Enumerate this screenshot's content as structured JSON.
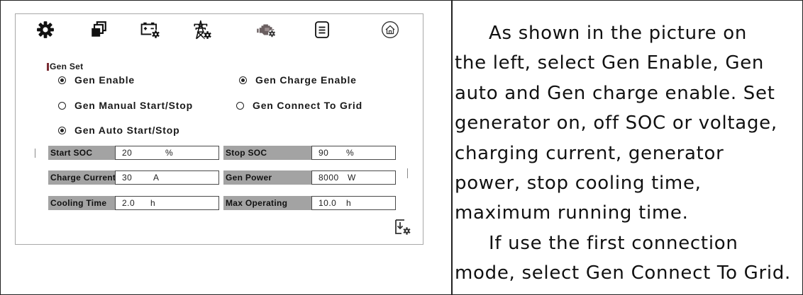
{
  "settings_panel": {
    "toolbar_icons": [
      "gear-icon",
      "stacked-windows-icon",
      "battery-setting-icon",
      "grid-tower-icon",
      "generator-icon",
      "document-icon",
      "home-icon"
    ],
    "section_title": "Gen Set",
    "options": [
      {
        "label": "Gen Enable",
        "selected": true
      },
      {
        "label": "Gen Charge Enable",
        "selected": true
      },
      {
        "label": "Gen Manual Start/Stop",
        "selected": false
      },
      {
        "label": "Gen Connect To Grid",
        "selected": false
      },
      {
        "label": "Gen Auto Start/Stop",
        "selected": true
      }
    ],
    "fields": [
      {
        "label": "Start SOC",
        "value": "20",
        "unit": "%"
      },
      {
        "label": "Stop SOC",
        "value": "90",
        "unit": "%"
      },
      {
        "label": "Charge Current",
        "value": "30",
        "unit": "A"
      },
      {
        "label": "Gen Power",
        "value": "8000",
        "unit": "W"
      },
      {
        "label": "Cooling Time",
        "value": "2.0",
        "unit": "h"
      },
      {
        "label": "Max Operating",
        "value": "10.0",
        "unit": "h"
      }
    ],
    "save_icon": "save-settings-icon"
  },
  "instructions": {
    "paragraph_1": [
      "As shown in the picture on",
      "the left, select Gen Enable, Gen",
      "auto and Gen charge enable. Set",
      "generator on, off SOC or voltage,",
      "charging current, generator",
      "power, stop cooling time,",
      "maximum running time."
    ],
    "paragraph_2": [
      "If use the first connection",
      "mode, select Gen Connect To Grid."
    ]
  },
  "colors": {
    "label_fill": "#a3a3a3",
    "section_marker": "#7a2c33",
    "text": "#111111",
    "border": "#222222"
  }
}
